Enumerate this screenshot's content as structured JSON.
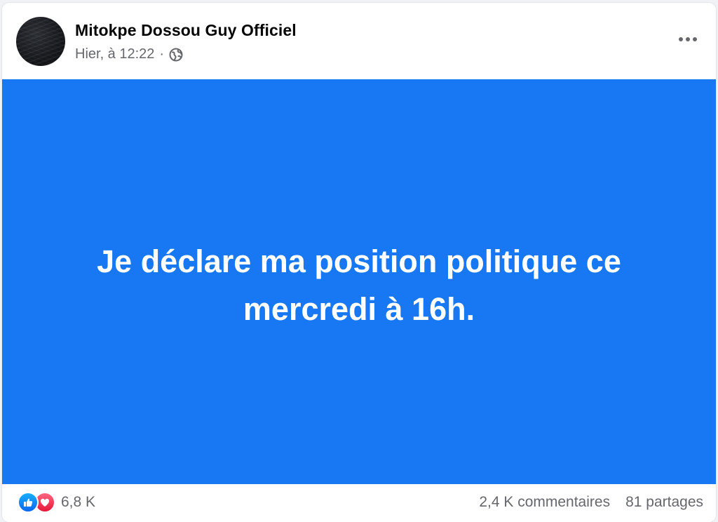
{
  "post": {
    "author": "Mitokpe Dossou Guy Officiel",
    "timestamp": "Hier, à 12:22",
    "separator": "·",
    "privacy_icon": "globe-icon",
    "more_icon": "more-options-icon",
    "text": "Je déclare ma position politique ce mercredi à 16h.",
    "background_color": "#1877f2",
    "text_color": "#ffffff"
  },
  "footer": {
    "reaction_icons": [
      "like-icon",
      "love-icon"
    ],
    "reaction_count": "6,8 K",
    "comments": "2,4 K commentaires",
    "shares": "81 partages"
  }
}
